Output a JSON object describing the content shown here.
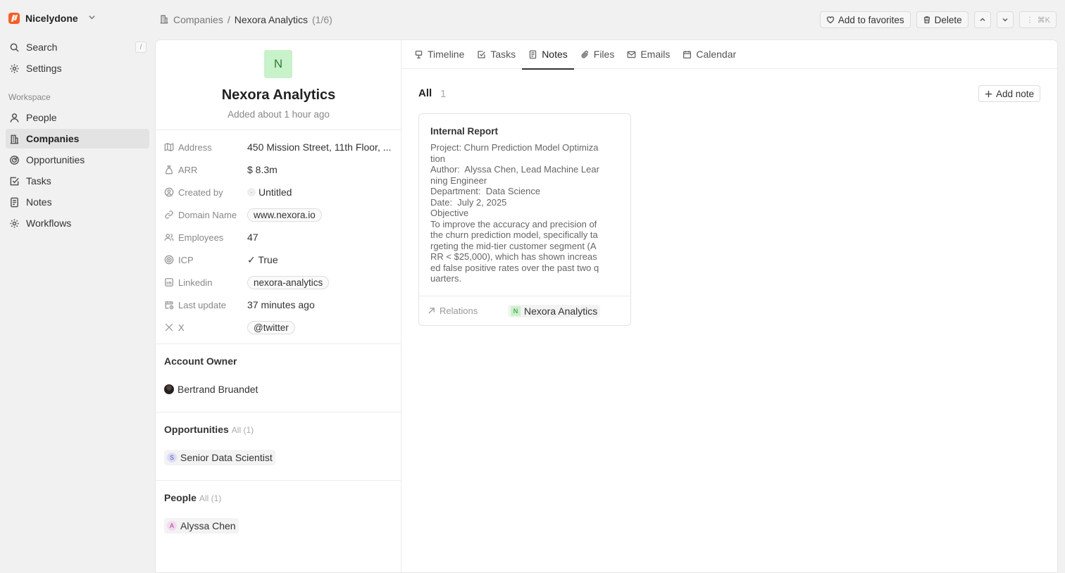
{
  "workspace": {
    "name": "Nicelydone"
  },
  "sidebar": {
    "search_label": "Search",
    "search_shortcut": "/",
    "settings_label": "Settings",
    "section_label": "Workspace",
    "items": [
      {
        "label": "People",
        "icon": "person-icon",
        "active": false
      },
      {
        "label": "Companies",
        "icon": "building-icon",
        "active": true
      },
      {
        "label": "Opportunities",
        "icon": "target-icon",
        "active": false
      },
      {
        "label": "Tasks",
        "icon": "checkbox-icon",
        "active": false
      },
      {
        "label": "Notes",
        "icon": "note-icon",
        "active": false
      },
      {
        "label": "Workflows",
        "icon": "gear-icon",
        "active": false
      }
    ]
  },
  "breadcrumb": {
    "parent": "Companies",
    "separator": "/",
    "current": "Nexora Analytics",
    "count": "(1/6)"
  },
  "actions": {
    "favorites": "Add to favorites",
    "delete": "Delete",
    "shortcut": "⌘K"
  },
  "company": {
    "initial": "N",
    "name": "Nexora Analytics",
    "added": "Added about 1 hour ago",
    "fields": [
      {
        "label": "Address",
        "value": "450 Mission Street, 11th Floor, ..."
      },
      {
        "label": "ARR",
        "value": "$ 8.3m"
      },
      {
        "label": "Created by",
        "value": "Untitled"
      },
      {
        "label": "Domain Name",
        "value": "www.nexora.io"
      },
      {
        "label": "Employees",
        "value": "47"
      },
      {
        "label": "ICP",
        "value": "✓ True"
      },
      {
        "label": "Linkedin",
        "value": "nexora-analytics"
      },
      {
        "label": "Last update",
        "value": "37 minutes ago"
      },
      {
        "label": "X",
        "value": "@twitter"
      }
    ],
    "account_owner_title": "Account Owner",
    "account_owner": "Bertrand Bruandet",
    "opportunities_title": "Opportunities",
    "opportunities_sub": "All (1)",
    "opportunity": {
      "initial": "S",
      "name": "Senior Data Scientist"
    },
    "people_title": "People",
    "people_sub": "All (1)",
    "person": {
      "initial": "A",
      "name": "Alyssa Chen"
    }
  },
  "tabs": [
    "Timeline",
    "Tasks",
    "Notes",
    "Files",
    "Emails",
    "Calendar"
  ],
  "notes": {
    "all_label": "All",
    "count": "1",
    "add_label": "Add note",
    "card": {
      "title": "Internal Report",
      "lines": [
        "Project: Churn Prediction Model Optimization",
        "Author:  Alyssa Chen, Lead Machine Learning Engineer",
        "Department:  Data Science",
        "Date:  July 2, 2025",
        "Objective",
        "To improve the accuracy and precision of the churn prediction model, specifically targeting the mid-tier customer segment (ARR < $25,000), which has shown increased false positive rates over the past two quarters."
      ],
      "relations_label": "Relations",
      "relation_initial": "N",
      "relation": "Nexora Analytics"
    }
  }
}
